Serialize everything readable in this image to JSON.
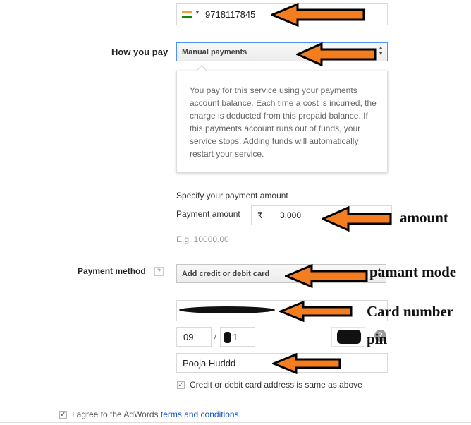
{
  "phone": {
    "number": "9718117845"
  },
  "how_you_pay": {
    "label": "How you pay",
    "selected": "Manual payments",
    "help": "You pay for this service using your payments account balance. Each time a cost is incurred, the charge is deducted from this prepaid balance. If this payments account runs out of funds, your service stops. Adding funds will automatically restart your service."
  },
  "payment_amount": {
    "heading": "Specify your payment amount",
    "label": "Payment amount",
    "currency": "₹",
    "value": "3,000",
    "hint": "E.g. 10000.00"
  },
  "payment_method": {
    "label": "Payment method",
    "help_badge": "?",
    "selected": "Add credit or debit card"
  },
  "card": {
    "month": "09",
    "separator": "/",
    "year_visible": "1",
    "name": "Pooja Huddd",
    "address_same_label": "Credit or debit card address is same as above"
  },
  "agree": {
    "prefix": "I agree to the AdWords ",
    "link": "terms and conditions",
    "suffix": "."
  },
  "annotations": {
    "amount": "amount",
    "mode": "pamant mode",
    "card_number": "Card number",
    "card_number_first": "C",
    "card_number_rest": "ard number",
    "pin": "pin"
  },
  "colors": {
    "arrow_fill": "#f47d20",
    "link": "#1155cc",
    "select_border_focus": "#4d90fe"
  }
}
